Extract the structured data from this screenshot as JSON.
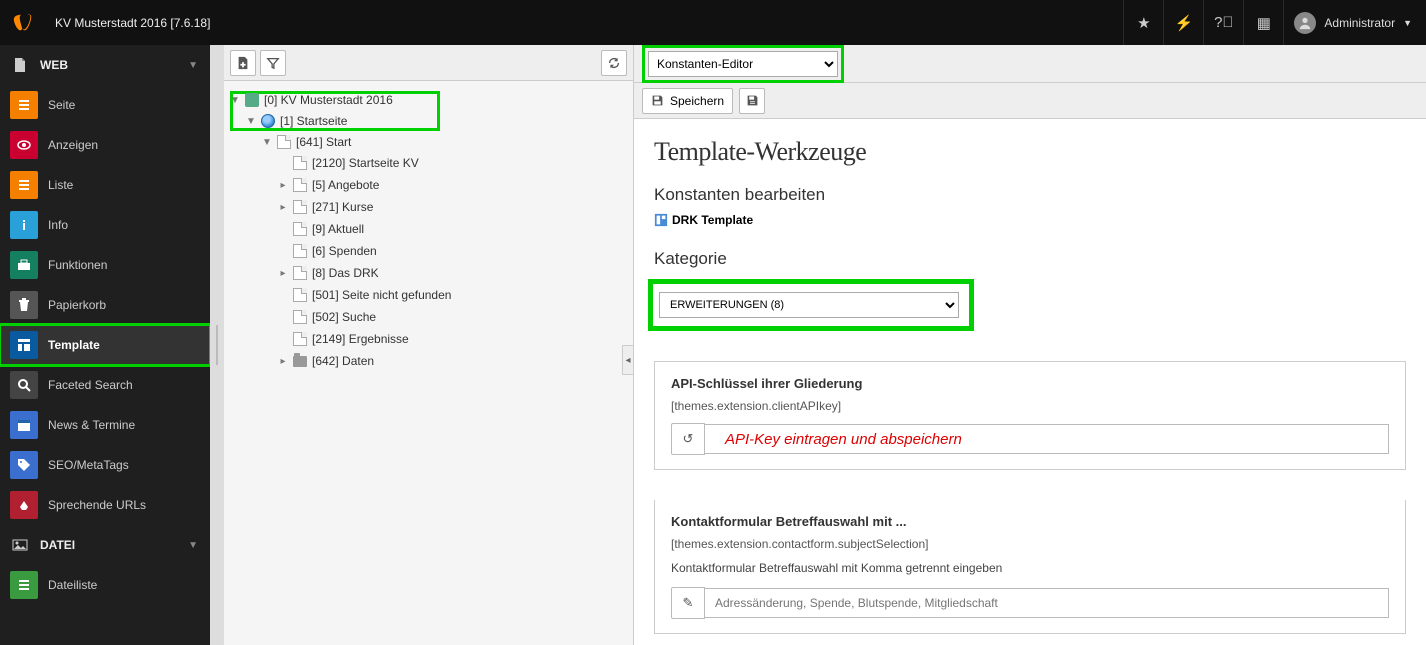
{
  "header": {
    "site_title": "KV Musterstadt 2016 [7.6.18]",
    "user_label": "Administrator"
  },
  "modules": {
    "group_web": "WEB",
    "group_file": "DATEI",
    "items": {
      "page": "Seite",
      "view": "Anzeigen",
      "list": "Liste",
      "info": "Info",
      "func": "Funktionen",
      "trash": "Papierkorb",
      "template": "Template",
      "faceted": "Faceted Search",
      "news": "News & Termine",
      "seo": "SEO/MetaTags",
      "urls": "Sprechende URLs",
      "filelist": "Dateiliste"
    }
  },
  "tree": {
    "root": "[0] KV Musterstadt 2016",
    "start": "[1] Startseite",
    "n641": "[641] Start",
    "n2120": "[2120] Startseite KV",
    "n5": "[5] Angebote",
    "n271": "[271] Kurse",
    "n9": "[9] Aktuell",
    "n6": "[6] Spenden",
    "n8": "[8] Das DRK",
    "n501": "[501] Seite nicht gefunden",
    "n502": "[502] Suche",
    "n2149": "[2149] Ergebnisse",
    "n642": "[642] Daten"
  },
  "editor": {
    "mode": "Konstanten-Editor",
    "save": "Speichern",
    "title": "Template-Werkzeuge",
    "subtitle": "Konstanten bearbeiten",
    "template_name": "DRK Template",
    "category_label": "Kategorie",
    "category_value": "ERWEITERUNGEN (8)"
  },
  "fields": {
    "api": {
      "title": "API-Schlüssel ihrer Gliederung",
      "key": "[themes.extension.clientAPIkey]",
      "note": "API-Key eintragen und abspeichern"
    },
    "contact": {
      "title": "Kontaktformular Betreffauswahl mit ...",
      "key": "[themes.extension.contactform.subjectSelection]",
      "desc": "Kontaktformular Betreffauswahl mit Komma getrennt eingeben",
      "placeholder": "Adressänderung, Spende, Blutspende, Mitgliedschaft"
    }
  }
}
